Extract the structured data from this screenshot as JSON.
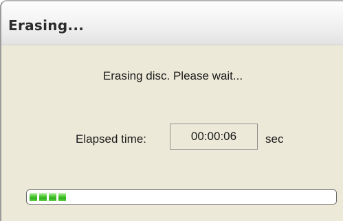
{
  "window": {
    "title": "Erasing..."
  },
  "dialog": {
    "message": "Erasing disc. Please wait...",
    "elapsed_label": "Elapsed time:",
    "elapsed_value": "00:00:06",
    "elapsed_unit": "sec"
  },
  "progress": {
    "fraction": 0.035,
    "segments": 4,
    "color": "#2fb11a"
  }
}
